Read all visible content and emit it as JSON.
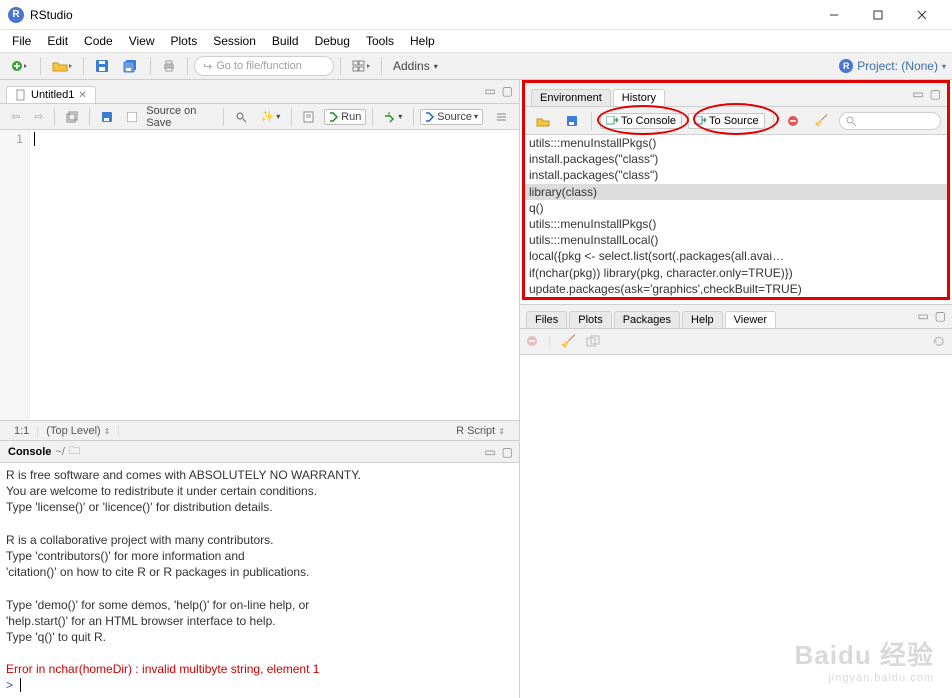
{
  "window": {
    "title": "RStudio"
  },
  "menu": [
    "File",
    "Edit",
    "Code",
    "View",
    "Plots",
    "Session",
    "Build",
    "Debug",
    "Tools",
    "Help"
  ],
  "toolbar": {
    "goto_placeholder": "Go to file/function",
    "addins": "Addins",
    "project_label": "Project: (None)"
  },
  "source": {
    "tab": "Untitled1",
    "source_on_save": "Source on Save",
    "run": "Run",
    "source_btn": "Source",
    "gutter": "1",
    "status_pos": "1:1",
    "status_scope": "(Top Level)",
    "status_lang": "R Script"
  },
  "console": {
    "title": "Console",
    "path": "~/",
    "lines": [
      "R is free software and comes with ABSOLUTELY NO WARRANTY.",
      "You are welcome to redistribute it under certain conditions.",
      "Type 'license()' or 'licence()' for distribution details.",
      "",
      "R is a collaborative project with many contributors.",
      "Type 'contributors()' for more information and",
      "'citation()' on how to cite R or R packages in publications.",
      "",
      "Type 'demo()' for some demos, 'help()' for on-line help, or",
      "'help.start()' for an HTML browser interface to help.",
      "Type 'q()' to quit R.",
      ""
    ],
    "error": "Error in nchar(homeDir) : invalid multibyte string, element 1",
    "prompt": ">"
  },
  "env_tabs": {
    "env": "Environment",
    "hist": "History"
  },
  "hist_tool": {
    "to_console": "To Console",
    "to_source": "To Source"
  },
  "history": [
    {
      "text": "utils:::menuInstallPkgs()",
      "sel": false
    },
    {
      "text": "install.packages(\"class\")",
      "sel": false
    },
    {
      "text": "install.packages(\"class\")",
      "sel": false
    },
    {
      "text": "library(class)",
      "sel": true
    },
    {
      "text": "q()",
      "sel": false
    },
    {
      "text": "utils:::menuInstallPkgs()",
      "sel": false
    },
    {
      "text": "utils:::menuInstallLocal()",
      "sel": false
    },
    {
      "text": "local({pkg <- select.list(sort(.packages(all.avai…",
      "sel": false
    },
    {
      "text": "if(nchar(pkg)) library(pkg, character.only=TRUE)})",
      "sel": false
    },
    {
      "text": "update.packages(ask='graphics',checkBuilt=TRUE)",
      "sel": false
    }
  ],
  "viewer_tabs": {
    "files": "Files",
    "plots": "Plots",
    "packages": "Packages",
    "help": "Help",
    "viewer": "Viewer"
  },
  "watermark": {
    "big": "Baidu 经验",
    "small": "jingyan.baidu.com"
  }
}
